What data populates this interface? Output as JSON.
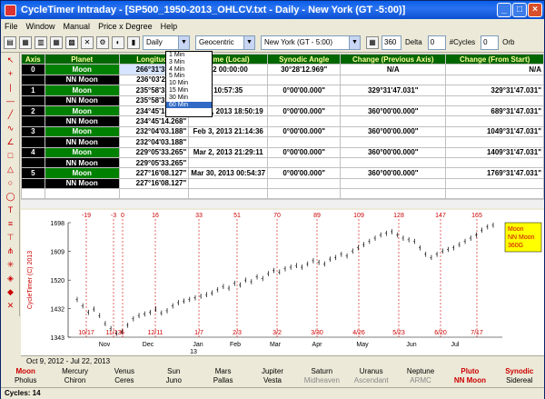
{
  "window": {
    "title": "CycleTimer Intraday - [SP500_1950-2013_OHLCV.txt - Daily - New York (GT -5:00)]"
  },
  "menu": [
    "File",
    "Window",
    "Manual",
    "Price x Degree",
    "Help"
  ],
  "toolbar": {
    "timeframe": "Daily",
    "coordinate": "Geocentric",
    "location": "New York (GT - 5:00)",
    "degrees": "360",
    "delta_label": "Delta",
    "delta_value": "0",
    "cycles_label": "#Cycles",
    "cycles_value": "0",
    "orb_label": "Orb"
  },
  "dropdown": {
    "options": [
      "1 Min",
      "3 Min",
      "4 Min",
      "5 Min",
      "10 Min",
      "15 Min",
      "30 Min",
      "60 Min"
    ],
    "highlighted": "60 Min"
  },
  "grid": {
    "headers": [
      "Axis",
      "Planet",
      "Longitude",
      "Time (Local)",
      "Synodic Angle",
      "Change (Previous Axis)",
      "Change (From Start)"
    ],
    "rows": [
      {
        "axis": "0",
        "planet": "Moon",
        "lon": "266°31'33.083\"",
        "date": "",
        "time": "00:00:00",
        "syn": "30°28'12.969\"",
        "prev": "N/A",
        "start": "N/A"
      },
      {
        "axis": "",
        "planet": "NN Moon",
        "lon": "236°03'20.114\"",
        "date": "",
        "time": "",
        "syn": "",
        "prev": "",
        "start": ""
      },
      {
        "axis": "1",
        "planet": "Moon",
        "lon": "235°58'31.184\"",
        "date": "",
        "time": "10:57:35",
        "syn": "0°00'00.000\"",
        "prev": "329°31'47.031\"",
        "start": "329°31'47.031\""
      },
      {
        "axis": "",
        "planet": "NN Moon",
        "lon": "235°58'31.184\"",
        "date": "",
        "time": "",
        "syn": "",
        "prev": "",
        "start": ""
      },
      {
        "axis": "2",
        "planet": "Moon",
        "lon": "234°45'14.268\"",
        "date": "Jan 7, 2013",
        "time": "18:50:19",
        "syn": "0°00'00.000\"",
        "prev": "360°00'00.000\"",
        "start": "689°31'47.031\""
      },
      {
        "axis": "",
        "planet": "NN Moon",
        "lon": "234°45'14.268\"",
        "date": "",
        "time": "",
        "syn": "",
        "prev": "",
        "start": ""
      },
      {
        "axis": "3",
        "planet": "Moon",
        "lon": "232°04'03.188\"",
        "date": "Feb 3, 2013",
        "time": "21:14:36",
        "syn": "0°00'00.000\"",
        "prev": "360°00'00.000\"",
        "start": "1049°31'47.031\""
      },
      {
        "axis": "",
        "planet": "NN Moon",
        "lon": "232°04'03.188\"",
        "date": "",
        "time": "",
        "syn": "",
        "prev": "",
        "start": ""
      },
      {
        "axis": "4",
        "planet": "Moon",
        "lon": "229°05'33.265\"",
        "date": "Mar 2, 2013",
        "time": "21:29:11",
        "syn": "0°00'00.000\"",
        "prev": "360°00'00.000\"",
        "start": "1409°31'47.031\""
      },
      {
        "axis": "",
        "planet": "NN Moon",
        "lon": "229°05'33.265\"",
        "date": "",
        "time": "",
        "syn": "",
        "prev": "",
        "start": ""
      },
      {
        "axis": "5",
        "planet": "Moon",
        "lon": "227°16'08.127\"",
        "date": "Mar 30, 2013",
        "time": "00:54:37",
        "syn": "0°00'00.000\"",
        "prev": "360°00'00.000\"",
        "start": "1769°31'47.031\""
      },
      {
        "axis": "",
        "planet": "NN Moon",
        "lon": "227°16'08.127\"",
        "date": "",
        "time": "",
        "syn": "",
        "prev": "",
        "start": ""
      },
      {
        "axis": "",
        "planet": "",
        "lon": "",
        "date": "",
        "time": "",
        "syn": "",
        "prev": "",
        "start": ""
      }
    ],
    "partial_date_row1": "12"
  },
  "chart_data": {
    "type": "line",
    "yticks": [
      1343,
      1432,
      1520,
      1609,
      1698
    ],
    "ylim": [
      1343,
      1698
    ],
    "ylabel": "CycleTimer (C) 2013",
    "month_labels": [
      "Nov",
      "Dec",
      "13",
      "Jan",
      "Feb",
      "Mar",
      "Apr",
      "May",
      "Jun",
      "Jul"
    ],
    "cycle_marks": [
      {
        "x_label": "10/17",
        "top": "-19"
      },
      {
        "x_label": "11/13",
        "top": "-3"
      },
      {
        "x_label": "6",
        "top": "0"
      },
      {
        "x_label": "12/11",
        "top": "16"
      },
      {
        "x_label": "1/7",
        "top": "33"
      },
      {
        "x_label": "2/3",
        "top": "51"
      },
      {
        "x_label": "3/2",
        "top": "70"
      },
      {
        "x_label": "3/30",
        "top": "89"
      },
      {
        "x_label": "4/26",
        "top": "109"
      },
      {
        "x_label": "5/23",
        "top": "128"
      },
      {
        "x_label": "6/20",
        "top": "147"
      },
      {
        "x_label": "7/17",
        "top": "165"
      }
    ],
    "legend": [
      "Moon",
      "NN Moon",
      "360G"
    ],
    "price_series": [
      1460,
      1440,
      1420,
      1430,
      1410,
      1385,
      1370,
      1355,
      1360,
      1380,
      1400,
      1410,
      1415,
      1420,
      1430,
      1418,
      1425,
      1440,
      1450,
      1455,
      1460,
      1465,
      1470,
      1475,
      1480,
      1490,
      1500,
      1495,
      1510,
      1505,
      1520,
      1515,
      1530,
      1525,
      1540,
      1550,
      1545,
      1555,
      1560,
      1565,
      1560,
      1570,
      1580,
      1575,
      1570,
      1585,
      1590,
      1600,
      1595,
      1610,
      1620,
      1630,
      1640,
      1650,
      1660,
      1665,
      1670,
      1660,
      1650,
      1645,
      1640,
      1620,
      1600,
      1590,
      1600,
      1610,
      1615,
      1620,
      1630,
      1640,
      1650,
      1660,
      1675,
      1685,
      1690
    ]
  },
  "datebar": {
    "start": "Oct 9, 2012",
    "end": "Jul 22, 2013"
  },
  "planets": [
    {
      "top": "Moon",
      "bottom": "Pholus",
      "highlight": true
    },
    {
      "top": "Mercury",
      "bottom": "Chiron",
      "highlight": false
    },
    {
      "top": "Venus",
      "bottom": "Ceres",
      "highlight": false
    },
    {
      "top": "Sun",
      "bottom": "Juno",
      "highlight": false
    },
    {
      "top": "Mars",
      "bottom": "Pallas",
      "highlight": false
    },
    {
      "top": "Jupiter",
      "bottom": "Vesta",
      "highlight": false
    },
    {
      "top": "Saturn",
      "bottom": "Midheaven",
      "highlight": false
    },
    {
      "top": "Uranus",
      "bottom": "Ascendant",
      "highlight": false
    },
    {
      "top": "Neptune",
      "bottom": "ARMC",
      "highlight": false
    },
    {
      "top": "Pluto",
      "bottom": "NN Moon",
      "highlight": true
    },
    {
      "top": "Synodic",
      "bottom": "Sidereal",
      "highlight": true
    }
  ],
  "status": {
    "cycles": "Cycles: 14"
  },
  "colors": {
    "header_green": "#006600",
    "row_black": "#000000",
    "row_green": "#008000",
    "cycle_red": "#cc0000",
    "legend_yellow": "#ffff00"
  }
}
